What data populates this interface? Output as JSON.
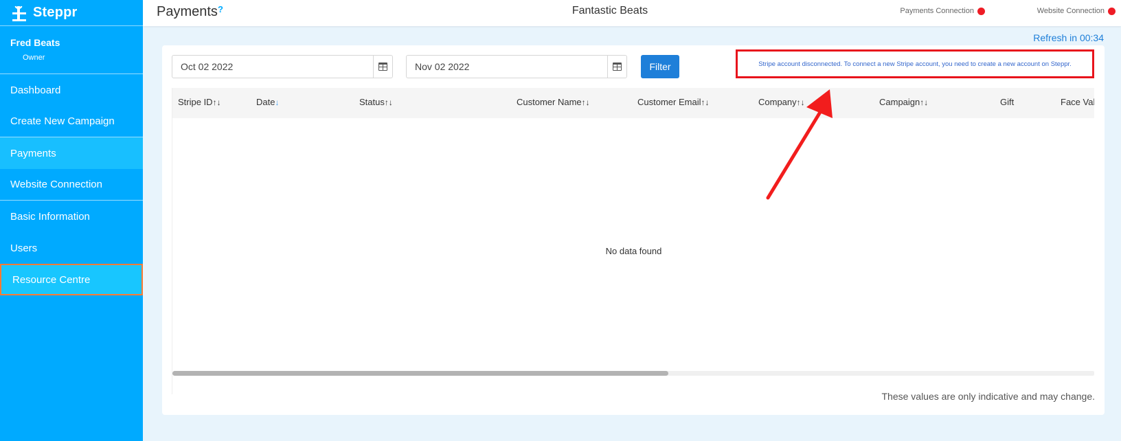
{
  "app": {
    "name": "Steppr"
  },
  "user": {
    "name": "Fred Beats",
    "role": "Owner"
  },
  "sidebar": {
    "items": [
      {
        "label": "Dashboard"
      },
      {
        "label": "Create New Campaign"
      },
      {
        "label": "Payments"
      },
      {
        "label": "Website Connection"
      },
      {
        "label": "Basic Information"
      },
      {
        "label": "Users"
      },
      {
        "label": "Resource Centre"
      }
    ]
  },
  "header": {
    "title": "Payments",
    "help": "?",
    "org": "Fantastic Beats",
    "payments_connection": "Payments Connection",
    "website_connection": "Website Connection"
  },
  "refresh": "Refresh in 00:34",
  "filters": {
    "start_date": "Oct 02 2022",
    "end_date": "Nov 02 2022",
    "filter_label": "Filter"
  },
  "notice": "Stripe account disconnected. To connect a new Stripe account, you need to create a new account on Steppr.",
  "table": {
    "columns": [
      {
        "label": "Stripe ID",
        "sort": "↑↓"
      },
      {
        "label": "Date",
        "sort": "↓"
      },
      {
        "label": "Status",
        "sort": "↑↓"
      },
      {
        "label": "Customer Name",
        "sort": "↑↓"
      },
      {
        "label": "Customer Email",
        "sort": "↑↓"
      },
      {
        "label": "Company",
        "sort": "↑↓"
      },
      {
        "label": "Campaign",
        "sort": "↑↓"
      },
      {
        "label": "Gift",
        "sort": ""
      },
      {
        "label": "Face Value",
        "sort": ""
      }
    ],
    "empty_text": "No data found"
  },
  "footnote": "These values are only indicative and may change.",
  "colors": {
    "sidebar": "#00aaff",
    "accent": "#1e7fd9",
    "status_disconnected": "#ee1c25",
    "annotation": "#e8141c"
  }
}
